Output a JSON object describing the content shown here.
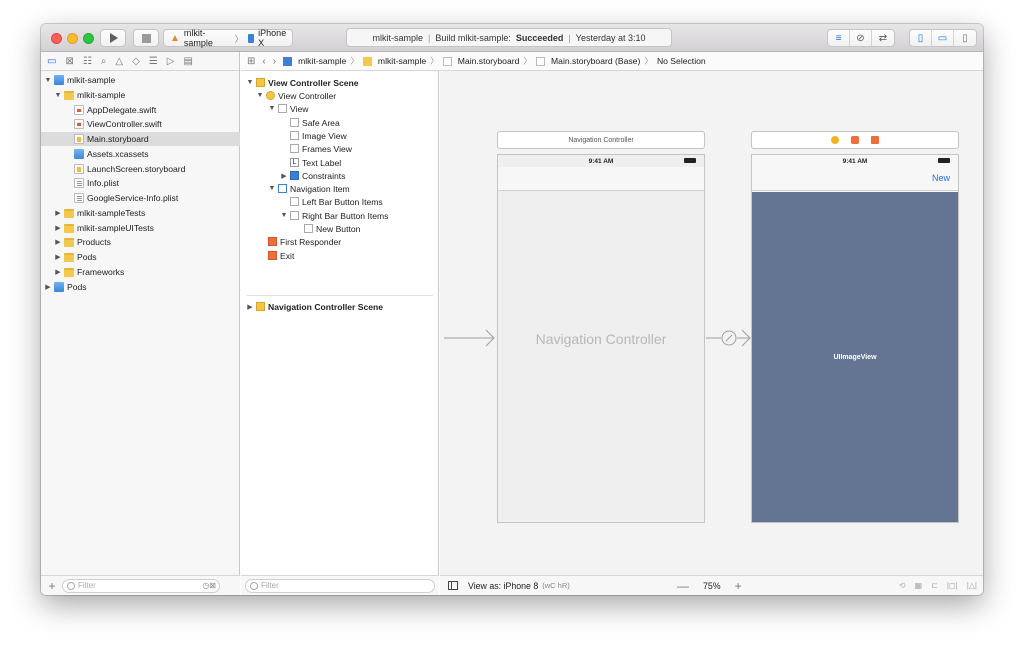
{
  "toolbar": {
    "scheme_target": "mlkit-sample",
    "scheme_device": "iPhone X",
    "activity": {
      "project": "mlkit-sample",
      "build_prefix": "Build mlkit-sample:",
      "build_status": "Succeeded",
      "timestamp": "Yesterday at 3:10"
    }
  },
  "navigator": {
    "items": [
      {
        "label": "mlkit-sample"
      },
      {
        "label": "mlkit-sample"
      },
      {
        "label": "AppDelegate.swift"
      },
      {
        "label": "ViewController.swift"
      },
      {
        "label": "Main.storyboard"
      },
      {
        "label": "Assets.xcassets"
      },
      {
        "label": "LaunchScreen.storyboard"
      },
      {
        "label": "Info.plist"
      },
      {
        "label": "GoogleService-Info.plist"
      },
      {
        "label": "mlkit-sampleTests"
      },
      {
        "label": "mlkit-sampleUITests"
      },
      {
        "label": "Products"
      },
      {
        "label": "Pods"
      },
      {
        "label": "Frameworks"
      },
      {
        "label": "Pods"
      }
    ],
    "filter_placeholder": "Filter"
  },
  "jumpbar": {
    "crumbs": [
      "mlkit-sample",
      "mlkit-sample",
      "Main.storyboard",
      "Main.storyboard (Base)",
      "No Selection"
    ]
  },
  "outline": {
    "items": [
      {
        "label": "View Controller Scene"
      },
      {
        "label": "View Controller"
      },
      {
        "label": "View"
      },
      {
        "label": "Safe Area"
      },
      {
        "label": "Image View"
      },
      {
        "label": "Frames View"
      },
      {
        "label": "Text Label"
      },
      {
        "label": "Constraints"
      },
      {
        "label": "Navigation Item"
      },
      {
        "label": "Left Bar Button Items"
      },
      {
        "label": "Right Bar Button Items"
      },
      {
        "label": "New Button"
      },
      {
        "label": "First Responder"
      },
      {
        "label": "Exit"
      },
      {
        "label": "Navigation Controller Scene"
      }
    ],
    "filter_placeholder": "Filter"
  },
  "canvas": {
    "nav_scene_title": "Navigation Controller",
    "status_time": "9:41 AM",
    "nav_controller_label": "Navigation Controller",
    "new_button": "New",
    "image_view_label": "UIImageView"
  },
  "footer": {
    "view_as": "View as: iPhone 8",
    "view_as_keys": "(wC hR)",
    "zoom": "75%"
  }
}
